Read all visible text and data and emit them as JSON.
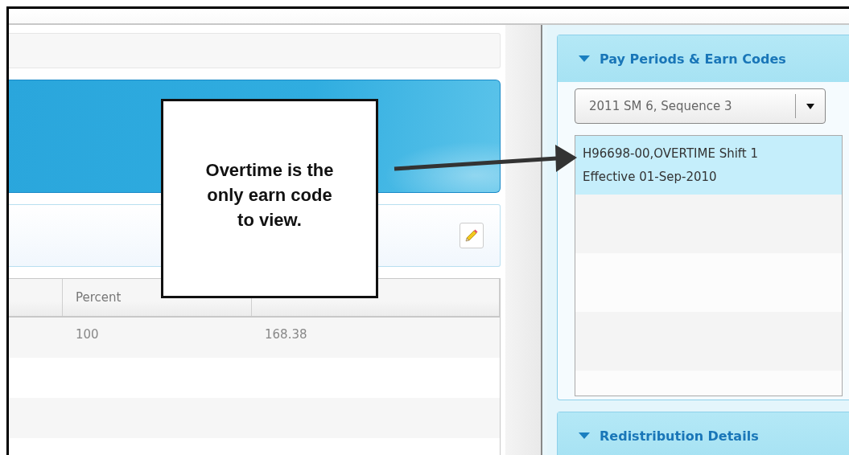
{
  "main": {
    "edit_button": {
      "kind": "pencil"
    },
    "table": {
      "columns": [
        {
          "label": "Percent"
        }
      ],
      "rows": [
        {
          "percent": "100",
          "column_3": "168.38"
        }
      ]
    }
  },
  "sidebar": {
    "panels": [
      {
        "title": "Pay Periods & Earn Codes",
        "expanded": true,
        "dropdown": {
          "value": "2011 SM 6, Sequence 3"
        },
        "items": [
          {
            "code": "H96698-00,OVERTIME Shift 1",
            "effective": "Effective 01-Sep-2010",
            "selected": true
          }
        ]
      },
      {
        "title": "Redistribution Details",
        "expanded": true
      }
    ]
  },
  "callout": {
    "text": "Overtime is the only earn code to view."
  }
}
